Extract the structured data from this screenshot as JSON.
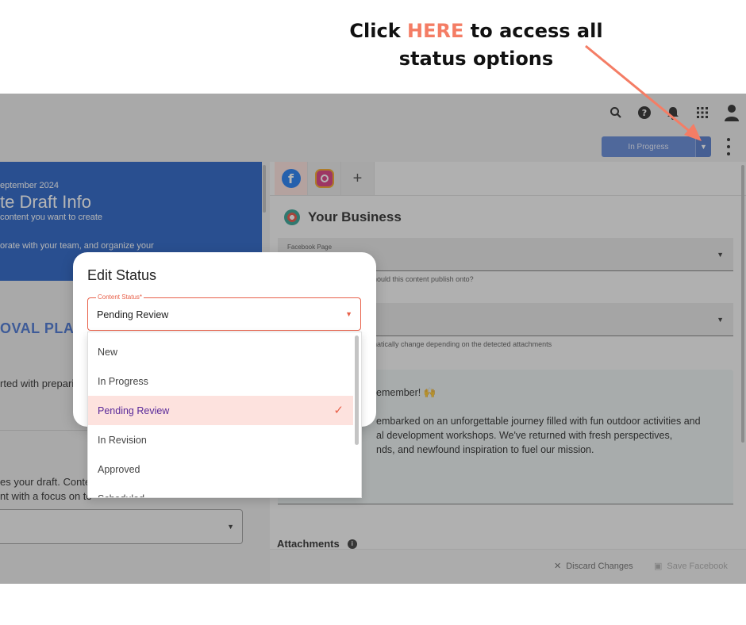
{
  "callout": {
    "prefix": "Click ",
    "highlight": "HERE",
    "suffix": " to access all",
    "line2": "status options"
  },
  "colors": {
    "accent": "#f47d65",
    "status_button": "#5b83d6",
    "banner": "#1d5bc4",
    "selected_row": "#fde2de"
  },
  "topbar": {
    "icons": [
      "search-icon",
      "help-icon",
      "bell-icon",
      "apps-grid-icon",
      "account-icon"
    ],
    "status_button_label": "In Progress"
  },
  "left_panel": {
    "banner_date": "eptember 2024",
    "banner_title": "te Draft Info",
    "banner_subtitle": "content you want to create",
    "banner_subtitle2": "orate with your team, and organize your",
    "approval_heading": "OVAL PLAN",
    "text1": "rted with prepari",
    "text2": "es your draft. Conte",
    "text3": "nt with a focus on te"
  },
  "right_panel": {
    "tabs": [
      "facebook-icon",
      "instagram-icon",
      "plus-icon"
    ],
    "business_name": "Your Business",
    "facebook_page_label": "Facebook Page",
    "facebook_page_helper": "hould this content publish onto?",
    "type_helper": "natically change depending on the detected attachments",
    "post_lines": [
      "emember! 🙌",
      "embarked on an unforgettable journey filled with fun outdoor activities and",
      "al development workshops. We've returned with fresh perspectives,",
      "nds, and newfound inspiration to fuel our mission."
    ],
    "attachments_label": "Attachments",
    "discard_label": "Discard Changes",
    "save_label": "Save Facebook"
  },
  "modal": {
    "title": "Edit Status",
    "field_label": "Content Status*",
    "field_value": "Pending Review",
    "options": [
      "New",
      "In Progress",
      "Pending Review",
      "In Revision",
      "Approved",
      "Scheduled"
    ],
    "selected_option": "Pending Review"
  }
}
